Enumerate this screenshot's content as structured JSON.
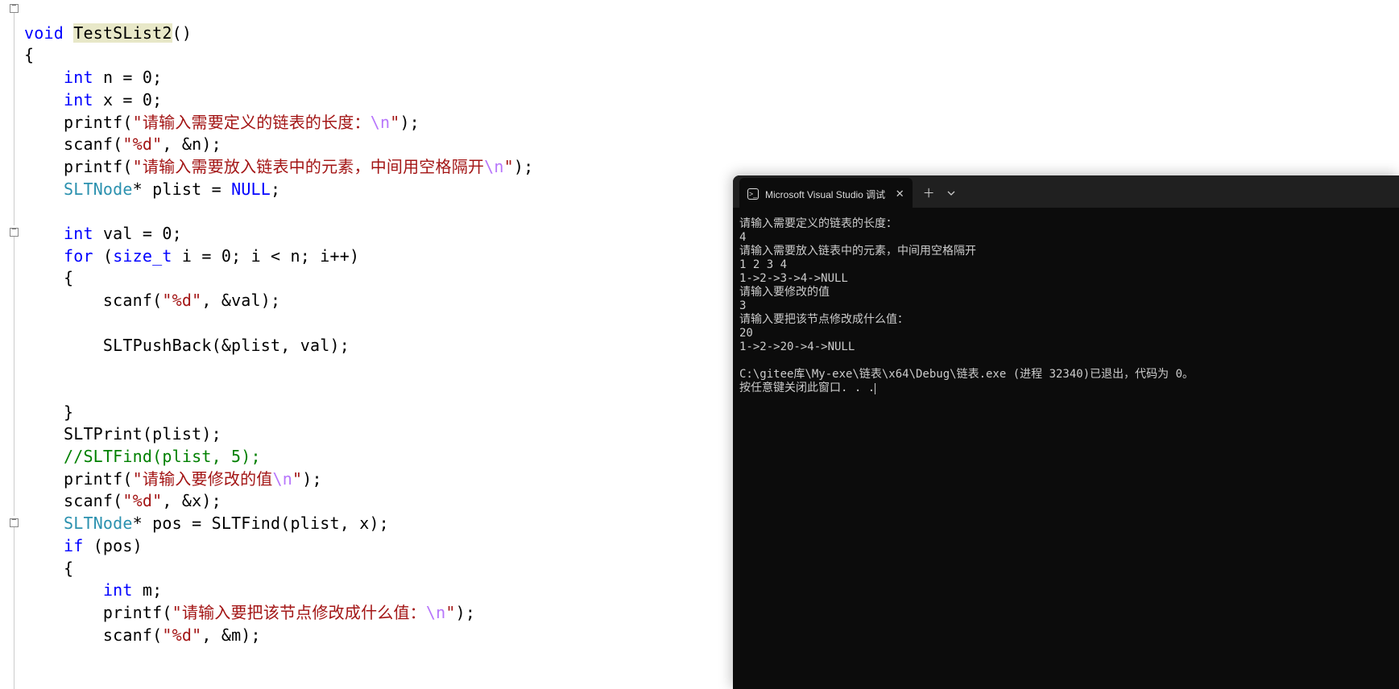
{
  "code": {
    "l1_void": "void ",
    "l1_fn": "TestSList2",
    "l1_rest": "()",
    "l2": "{",
    "l3_a": "    ",
    "l3_int": "int",
    "l3_b": " n = 0;",
    "l4_a": "    ",
    "l4_int": "int",
    "l4_b": " x = 0;",
    "l5_a": "    printf(",
    "l5_s": "\"请输入需要定义的链表的长度：",
    "l5_esc": "\\n",
    "l5_s2": "\"",
    "l5_b": ");",
    "l6_a": "    scanf(",
    "l6_s": "\"%d\"",
    "l6_b": ", &n);",
    "l7_a": "    printf(",
    "l7_s": "\"请输入需要放入链表中的元素，中间用空格隔开",
    "l7_esc": "\\n",
    "l7_s2": "\"",
    "l7_b": ");",
    "l8_a": "    ",
    "l8_t": "SLTNode",
    "l8_b": "* plist = ",
    "l8_null": "NULL",
    "l8_c": ";",
    "l9": "",
    "l10_a": "    ",
    "l10_int": "int",
    "l10_b": " val = 0;",
    "l11_a": "    ",
    "l11_for": "for",
    "l11_b": " (",
    "l11_t": "size_t",
    "l11_c": " i = 0; i < n; i++)",
    "l12": "    {",
    "l13_a": "        scanf(",
    "l13_s": "\"%d\"",
    "l13_b": ", &val);",
    "l14": "",
    "l15": "        SLTPushBack(&plist, val);",
    "l16": "",
    "l17": "",
    "l18": "    }",
    "l19": "    SLTPrint(plist);",
    "l20": "    //SLTFind(plist, 5);",
    "l21_a": "    printf(",
    "l21_s": "\"请输入要修改的值",
    "l21_esc": "\\n",
    "l21_s2": "\"",
    "l21_b": ");",
    "l22_a": "    scanf(",
    "l22_s": "\"%d\"",
    "l22_b": ", &x);",
    "l23_a": "    ",
    "l23_t": "SLTNode",
    "l23_b": "* pos = SLTFind(plist, x);",
    "l24_a": "    ",
    "l24_if": "if",
    "l24_b": " (pos)",
    "l25": "    {",
    "l26_a": "        ",
    "l26_int": "int",
    "l26_b": " m;",
    "l27_a": "        printf(",
    "l27_s": "\"请输入要把该节点修改成什么值：",
    "l27_esc": "\\n",
    "l27_s2": "\"",
    "l27_b": ");",
    "l28_a": "        scanf(",
    "l28_s": "\"%d\"",
    "l28_b": ", &m);"
  },
  "terminal": {
    "tab_title": "Microsoft Visual Studio 调试",
    "lines": [
      "请输入需要定义的链表的长度：",
      "4",
      "请输入需要放入链表中的元素，中间用空格隔开",
      "1 2 3 4",
      "1->2->3->4->NULL",
      "请输入要修改的值",
      "3",
      "请输入要把该节点修改成什么值：",
      "20",
      "1->2->20->4->NULL",
      "",
      "C:\\gitee库\\My-exe\\链表\\x64\\Debug\\链表.exe (进程 32340)已退出，代码为 0。",
      "按任意键关闭此窗口. . ."
    ]
  }
}
